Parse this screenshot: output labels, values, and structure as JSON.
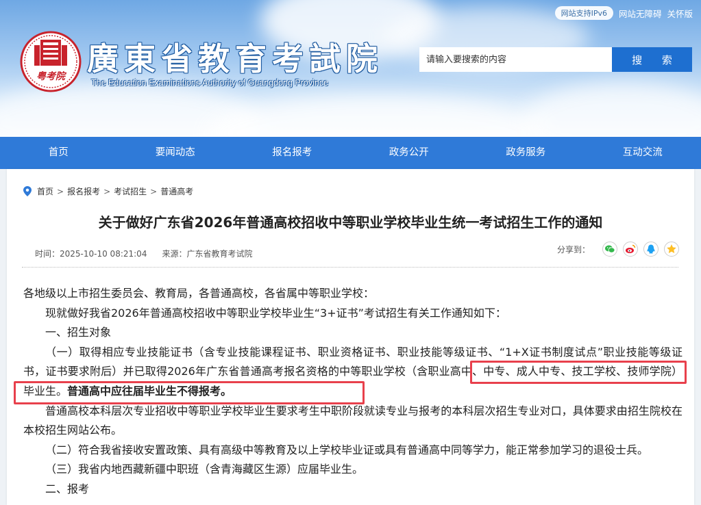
{
  "topbar": {
    "ipv6": "网站支持IPv6",
    "accessibility": "网站无障碍",
    "care": "关怀版"
  },
  "site": {
    "title": "廣東省教育考試院",
    "subtitle": "The Education Examinations Authority of Guangdong Province",
    "seal_text": "粤考院"
  },
  "search": {
    "placeholder": "请输入要搜索的内容",
    "button": "搜 索"
  },
  "nav": {
    "items": [
      "首页",
      "要闻动态",
      "报名报考",
      "政务公开",
      "政务服务",
      "互动交流"
    ]
  },
  "breadcrumb": [
    "首页",
    "报名报考",
    "考试招生",
    "普通高考"
  ],
  "article": {
    "title": "关于做好广东省2026年普通高校招收中等职业学校毕业生统一考试招生工作的通知",
    "time": "时间：2025-10-10 08:21:04",
    "source": "来源：广东省教育考试院",
    "share_label": "分享到："
  },
  "body": {
    "p1": "各地级以上市招生委员会、教育局，各普通高校，各省属中等职业学校：",
    "p2": "现就做好我省2026年普通高校招收中等职业学校毕业生“3+证书”考试招生有关工作通知如下：",
    "p3": "一、招生对象",
    "p4a": "（一）取得相应专业技能证书（含专业技能课程证书、职业资格证书、职业技能等级证书、“1+X证书制度试点”职业技能等级证书，证书要求附后）并已取得2026年广东省普通高考报名资格的中等职业学校（含职业高中、中专、成人中专、技工学校、技师学院）毕业生。",
    "p4b": "普通高中应往届毕业生不得报考。",
    "p5": "普通高校本科层次专业招收中等职业学校毕业生要求考生中职阶段就读专业与报考的本科层次招生专业对口，具体要求由招生院校在本校招生网站公布。",
    "p6": "（二）符合我省接收安置政策、具有高级中等教育及以上学校毕业证或具有普通高中同等学力，能正常参加学习的退役士兵。",
    "p7": "（三）我省内地西藏新疆中职班（含青海藏区生源）应届毕业生。",
    "p8": "二、报考"
  },
  "colors": {
    "nav_bg": "#2f7ad8",
    "search_button": "#1e6fd0",
    "highlight": "#e8404c",
    "seal_red": "#c8232c"
  }
}
